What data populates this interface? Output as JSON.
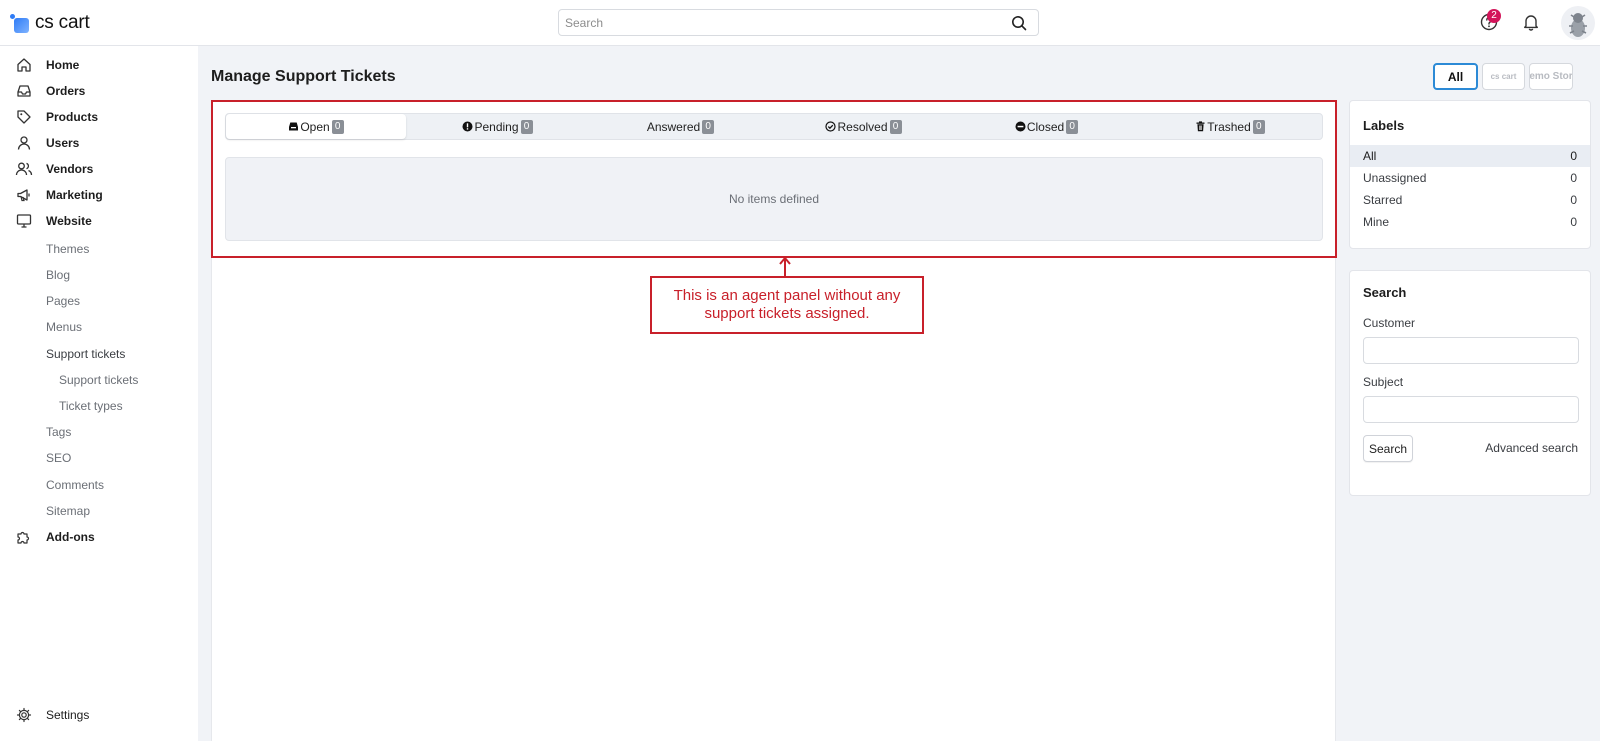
{
  "header": {
    "logo_text": "cs cart",
    "search_placeholder": "Search",
    "help_badge_count": "2"
  },
  "sidebar": {
    "items": [
      {
        "label": "Home",
        "icon": "home-icon"
      },
      {
        "label": "Orders",
        "icon": "inbox-icon"
      },
      {
        "label": "Products",
        "icon": "tag-icon"
      },
      {
        "label": "Users",
        "icon": "user-icon"
      },
      {
        "label": "Vendors",
        "icon": "users-icon"
      },
      {
        "label": "Marketing",
        "icon": "megaphone-icon"
      },
      {
        "label": "Website",
        "icon": "monitor-icon"
      }
    ],
    "website_sub": [
      "Themes",
      "Blog",
      "Pages",
      "Menus",
      "Support tickets"
    ],
    "support_sub": [
      "Support tickets",
      "Ticket types"
    ],
    "website_sub_after": [
      "Tags",
      "SEO",
      "Comments",
      "Sitemap"
    ],
    "addons_label": "Add-ons",
    "settings_label": "Settings"
  },
  "main": {
    "title": "Manage Support Tickets",
    "stores": {
      "all": "All",
      "cs": "cs cart",
      "demo": "emo Stor"
    },
    "tabs": [
      {
        "label": "Open",
        "count": "0",
        "icon": "inbox-icon"
      },
      {
        "label": "Pending",
        "count": "0",
        "icon": "exclamation-circle-icon"
      },
      {
        "label": "Answered",
        "count": "0",
        "icon": ""
      },
      {
        "label": "Resolved",
        "count": "0",
        "icon": "check-circle-icon"
      },
      {
        "label": "Closed",
        "count": "0",
        "icon": "minus-circle-icon"
      },
      {
        "label": "Trashed",
        "count": "0",
        "icon": "trash-icon"
      }
    ],
    "empty_text": "No items defined",
    "annotation": "This is an agent panel without any support tickets assigned."
  },
  "labels_panel": {
    "title": "Labels",
    "rows": [
      {
        "name": "All",
        "count": "0"
      },
      {
        "name": "Unassigned",
        "count": "0"
      },
      {
        "name": "Starred",
        "count": "0"
      },
      {
        "name": "Mine",
        "count": "0"
      }
    ]
  },
  "search_panel": {
    "title": "Search",
    "customer_label": "Customer",
    "subject_label": "Subject",
    "search_button": "Search",
    "advanced_link": "Advanced search"
  },
  "colors": {
    "accent": "#2c8ad6",
    "annotation": "#c8202a",
    "badge": "#d3155a"
  }
}
